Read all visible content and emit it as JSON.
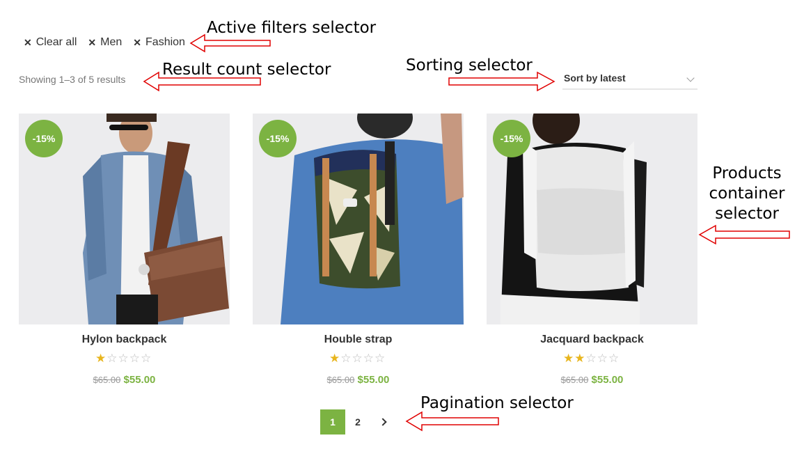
{
  "filters": [
    {
      "label": "Clear all"
    },
    {
      "label": "Men"
    },
    {
      "label": "Fashion"
    }
  ],
  "result_count": "Showing 1–3 of 5 results",
  "sort": {
    "label": "Sort by latest"
  },
  "products": [
    {
      "title": "Hylon backpack",
      "badge": "-15%",
      "rating": 1,
      "old_price": "$65.00",
      "price": "$55.00"
    },
    {
      "title": "Houble strap",
      "badge": "-15%",
      "rating": 1,
      "old_price": "$65.00",
      "price": "$55.00"
    },
    {
      "title": "Jacquard backpack",
      "badge": "-15%",
      "rating": 2,
      "old_price": "$65.00",
      "price": "$55.00"
    }
  ],
  "pagination": {
    "pages": [
      "1",
      "2"
    ],
    "current": "1"
  },
  "annotations": {
    "active_filters": "Active filters selector",
    "result_count": "Result count selector",
    "sorting": "Sorting selector",
    "products_line1": "Products",
    "products_line2": "container",
    "products_line3": "selector",
    "pagination": "Pagination selector"
  },
  "colors": {
    "accent": "#7cb342",
    "star": "#e8b51d",
    "arrow": "#e00000"
  }
}
